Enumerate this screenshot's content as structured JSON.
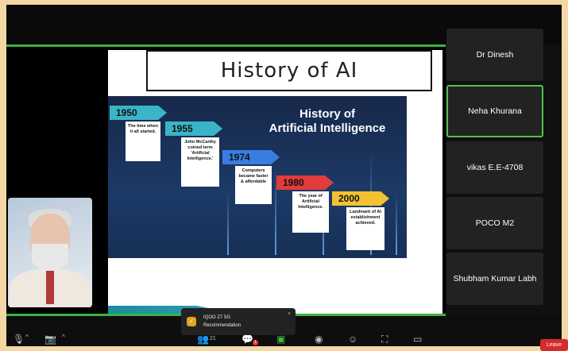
{
  "slide": {
    "title": "History of  AI",
    "inner_title_line1": "History of",
    "inner_title_line2": "Artificial Intelligence",
    "milestones": [
      {
        "year": "1950",
        "desc": "The time when it all started.",
        "color": "#3ab5c8"
      },
      {
        "year": "1955",
        "desc": "John McCarthy coined term 'Artificial Intelligence.'",
        "color": "#3ab5c8"
      },
      {
        "year": "1974",
        "desc": "Computers became faster & affordable",
        "color": "#3a7de0"
      },
      {
        "year": "1980",
        "desc": "The year of Artificial Intelligence.",
        "color": "#e23b3b"
      },
      {
        "year": "2000",
        "desc": "Landmark of AI establishment achieved.",
        "color": "#f2c232"
      }
    ]
  },
  "participants": [
    {
      "name": "Dr Dinesh",
      "active": false
    },
    {
      "name": "Neha Khurana",
      "active": true
    },
    {
      "name": "vikas E.E-4708",
      "active": false
    },
    {
      "name": "POCO M2",
      "active": false
    },
    {
      "name": "Shubham Kumar Labh",
      "active": false
    }
  ],
  "toast": {
    "title": "IQOO Z7 5G",
    "subtitle": "Recommendation",
    "close": "×"
  },
  "toolbar": {
    "participants_count": "21",
    "chat_badge": "1",
    "leave": "Leave"
  },
  "colors": {
    "active_border": "#4ec24e",
    "leave": "#d42b2b",
    "background": "#f3d7a4"
  }
}
